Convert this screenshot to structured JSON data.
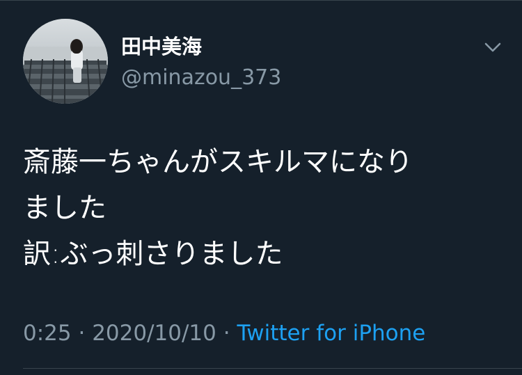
{
  "tweet": {
    "display_name": "田中美海",
    "handle": "@minazou_373",
    "body_lines": [
      "斎藤一ちゃんがスキルマになり",
      "ました",
      "訳:ぶっ刺さりました"
    ],
    "time": "0:25",
    "date": "2020/10/10",
    "separator": "·",
    "source": "Twitter for iPhone"
  },
  "icons": {
    "menu": "chevron-down-icon",
    "avatar": "profile-photo"
  },
  "colors": {
    "background": "#15202b",
    "text": "#ffffff",
    "muted": "#8899a6",
    "link": "#1da1f2",
    "divider": "#38444d"
  }
}
